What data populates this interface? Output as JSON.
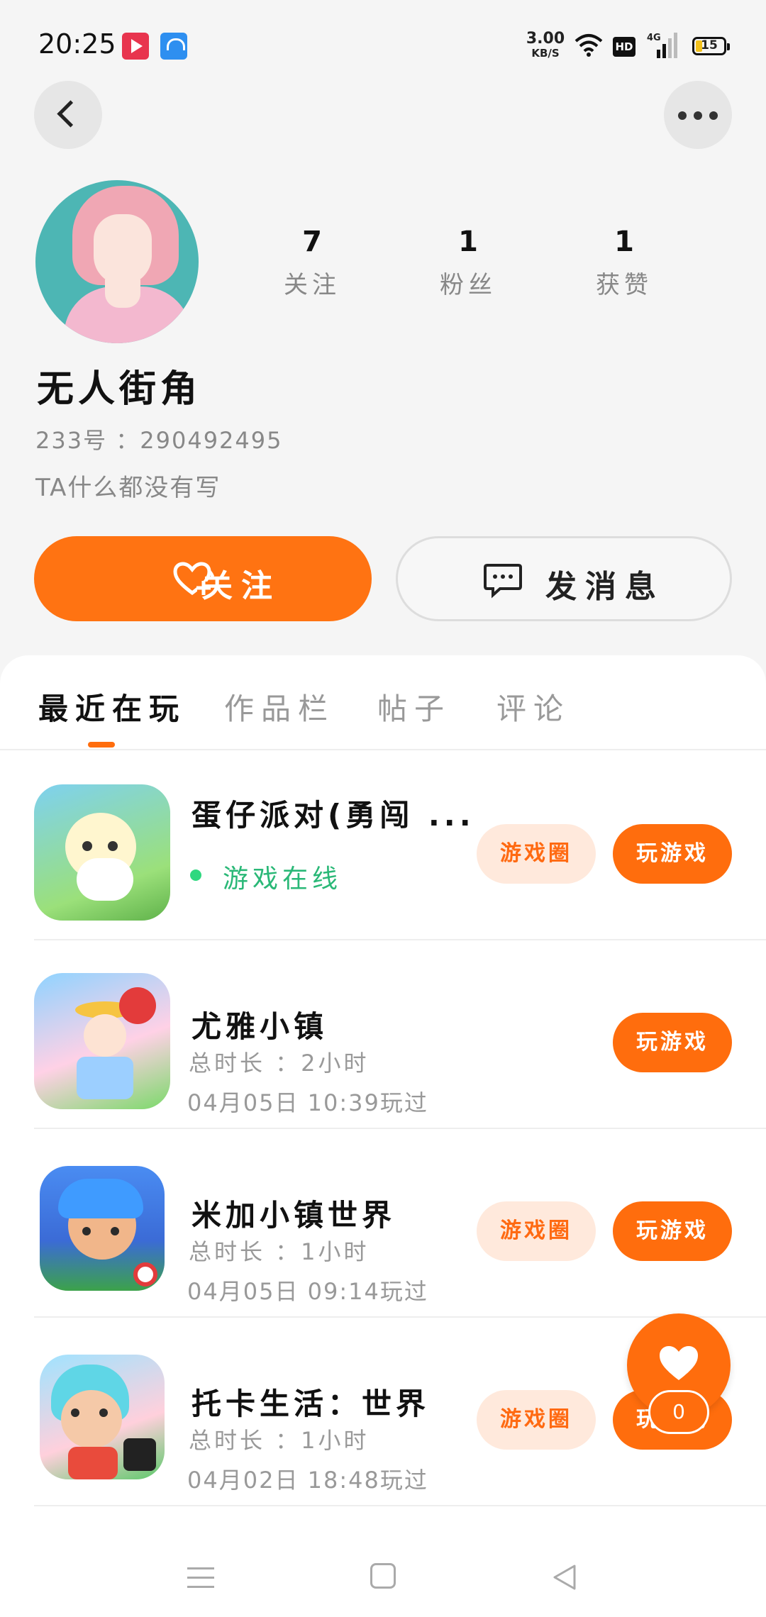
{
  "status_bar": {
    "time": "20:25",
    "net_speed_value": "3.00",
    "net_speed_unit": "KB/S",
    "hd": "HD",
    "network": "4G",
    "battery": "15"
  },
  "profile": {
    "stats": [
      {
        "value": "7",
        "label": "关注"
      },
      {
        "value": "1",
        "label": "粉丝"
      },
      {
        "value": "1",
        "label": "获赞"
      }
    ],
    "name": "无人街角",
    "id_text": "233号 ：290492495",
    "bio": "TA什么都没有写",
    "follow_label": "关注",
    "message_label": "发消息"
  },
  "tabs": [
    "最近在玩",
    "作品栏",
    "帖子",
    "评论"
  ],
  "games": [
    {
      "title": "蛋仔派对(勇闯 ...",
      "status": "游戏在线",
      "circle_label": "游戏圈",
      "play_label": "玩游戏"
    },
    {
      "title": "尤雅小镇",
      "duration": "总时长 ：2小时",
      "last_played": "04月05日 10:39玩过",
      "play_label": "玩游戏"
    },
    {
      "title": "米加小镇世界",
      "duration": "总时长 ：1小时",
      "last_played": "04月05日 09:14玩过",
      "circle_label": "游戏圈",
      "play_label": "玩游戏"
    },
    {
      "title": "托卡生活：世界",
      "duration": "总时长 ：1小时",
      "last_played": "04月02日 18:48玩过",
      "circle_label": "游戏圈",
      "play_label": "玩游戏"
    }
  ],
  "like_count": "0",
  "colors": {
    "accent": "#ff6d0d",
    "online": "#2ab877"
  }
}
